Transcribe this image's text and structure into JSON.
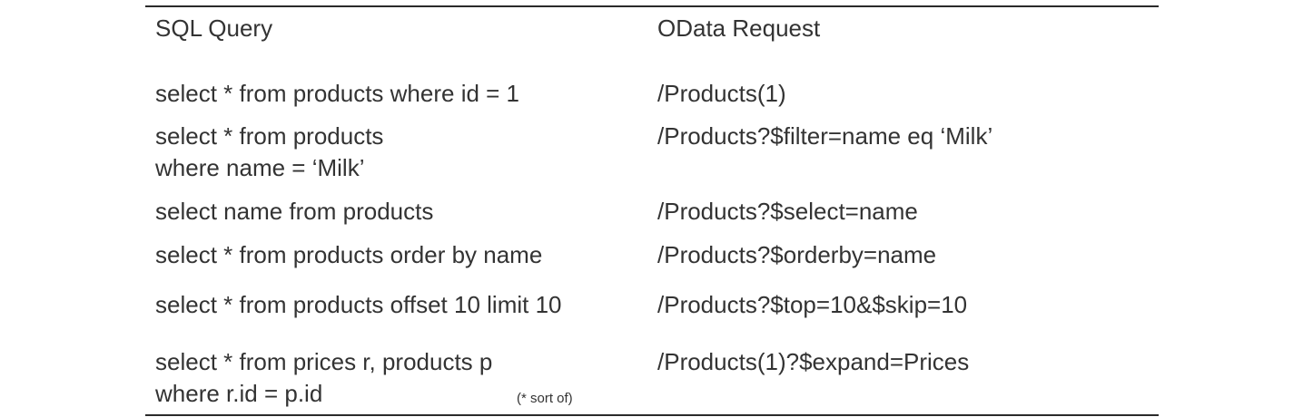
{
  "headers": {
    "sql": "SQL Query",
    "odata": "OData Request"
  },
  "rows": [
    {
      "sql": [
        "select * from products where id = 1"
      ],
      "odata": "/Products(1)"
    },
    {
      "sql": [
        "select * from products",
        "where name = ‘Milk’"
      ],
      "odata": "/Products?$filter=name eq ‘Milk’"
    },
    {
      "sql": [
        "select name from products"
      ],
      "odata": "/Products?$select=name"
    },
    {
      "sql": [
        "select * from products order by name"
      ],
      "odata": "/Products?$orderby=name"
    },
    {
      "sql": [
        "select * from products offset 10 limit 10"
      ],
      "odata": "/Products?$top=10&$skip=10"
    },
    {
      "sql": [
        "select * from prices r, products p",
        "where r.id = p.id"
      ],
      "odata": "/Products(1)?$expand=Prices"
    }
  ],
  "note": "(* sort of)"
}
